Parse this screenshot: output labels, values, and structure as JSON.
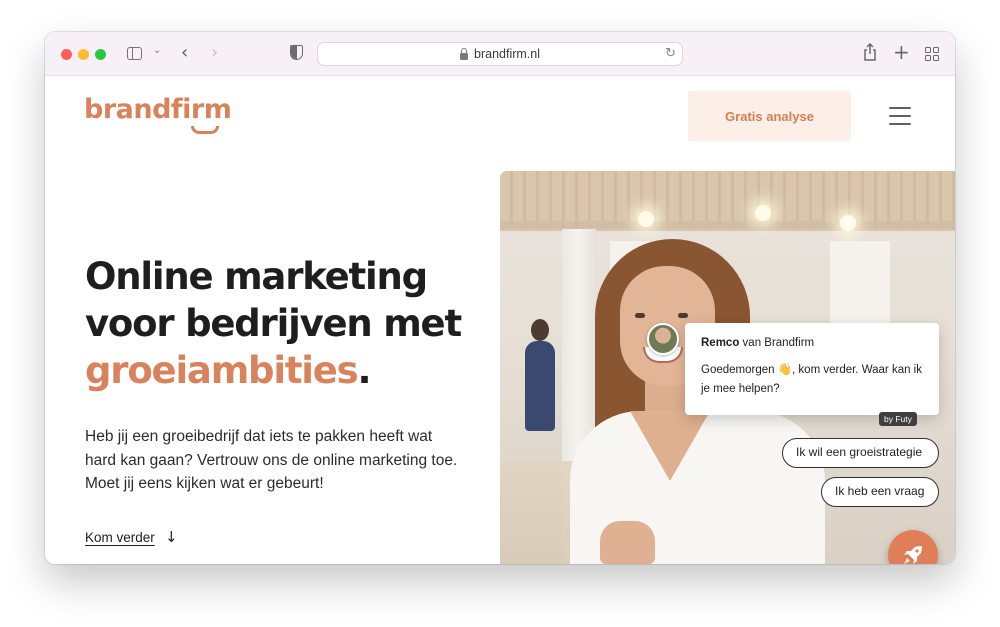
{
  "browser": {
    "url": "brandfirm.nl"
  },
  "site": {
    "logo": "brandfirm",
    "cta_label": "Gratis analyse"
  },
  "hero": {
    "title_line1": "Online marketing",
    "title_line2": "voor bedrijven met",
    "title_accent": "groeiambities",
    "title_period": ".",
    "text": "Heb jij een groeibedrijf dat iets te pakken heeft wat hard kan gaan? Vertrouw ons de online marketing toe. Moet jij eens kijken wat er gebeurt!",
    "link": "Kom verder",
    "link_arrow": "↓"
  },
  "chat": {
    "agent_name": "Remco",
    "agent_company": " van Brandfirm",
    "message": "Goedemorgen 👋, kom verder. Waar kan ik je mee helpen?",
    "powered_by": "by Futy",
    "options": [
      "Ik wil een groeistrategie",
      "Ik heb een vraag"
    ]
  },
  "colors": {
    "accent": "#d9835d",
    "cta_bg": "#fcefe8",
    "rocket_bg": "#e07f57"
  },
  "icons": [
    "sidebar-icon",
    "chevron-down-icon",
    "back-icon",
    "forward-icon",
    "shield-icon",
    "lock-icon",
    "reload-icon",
    "share-icon",
    "plus-icon",
    "tabs-icon",
    "menu-icon",
    "arrow-down-icon",
    "rocket-icon"
  ]
}
